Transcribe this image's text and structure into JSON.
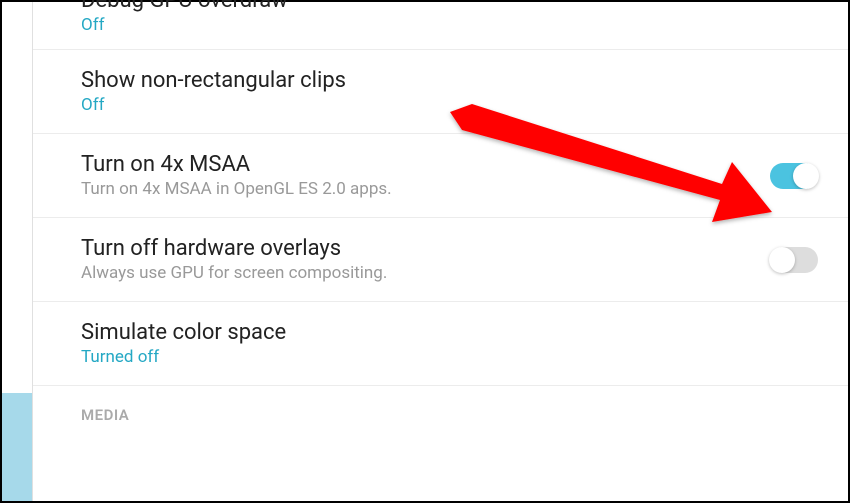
{
  "settings": [
    {
      "title": "Debug GPU overdraw",
      "value": "Off",
      "type": "link"
    },
    {
      "title": "Show non-rectangular clips",
      "value": "Off",
      "type": "link"
    },
    {
      "title": "Turn on 4x MSAA",
      "subtitle": "Turn on 4x MSAA in OpenGL ES 2.0 apps.",
      "type": "toggle",
      "enabled": true
    },
    {
      "title": "Turn off hardware overlays",
      "subtitle": "Always use GPU for screen compositing.",
      "type": "toggle",
      "enabled": false
    },
    {
      "title": "Simulate color space",
      "value": "Turned off",
      "type": "link"
    }
  ],
  "section_header": "MEDIA"
}
